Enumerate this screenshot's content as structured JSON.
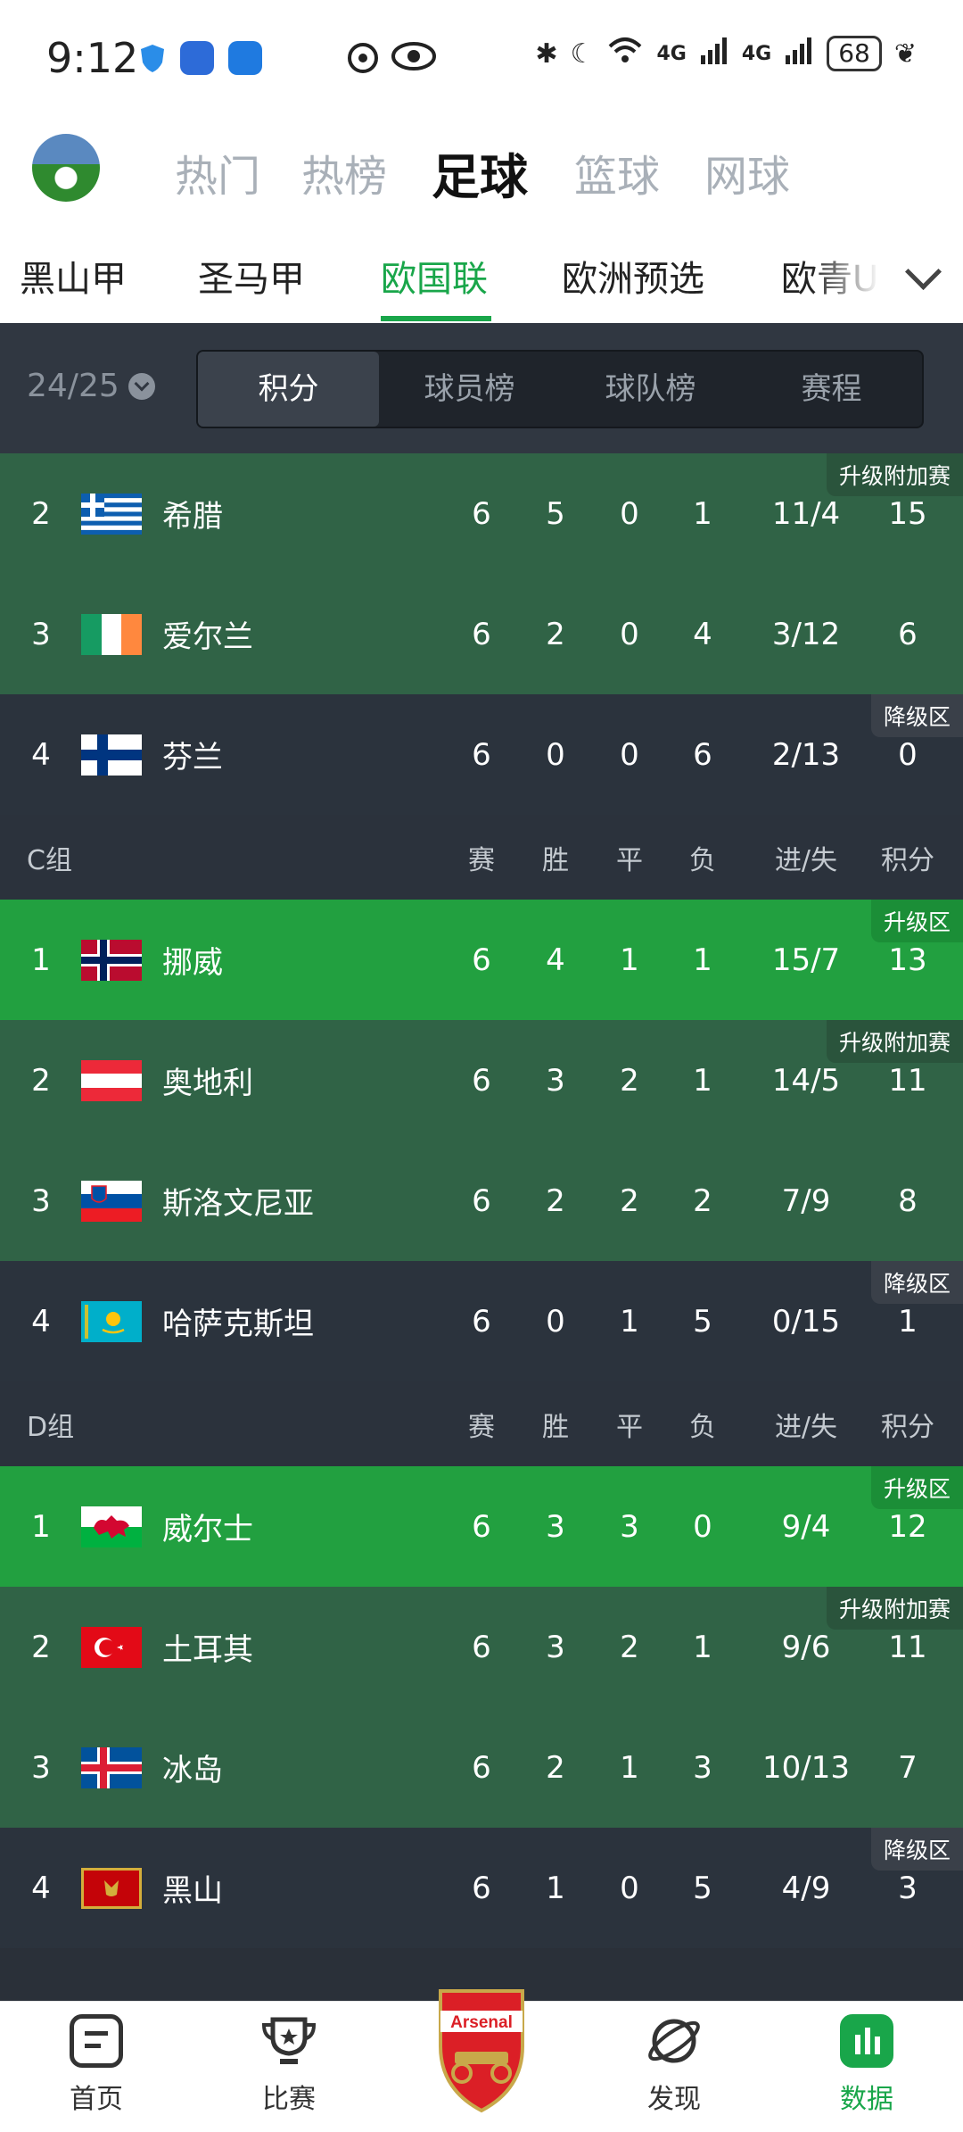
{
  "status_bar": {
    "time": "9:12",
    "signal_left": "4G",
    "signal_right": "4G",
    "battery": "68"
  },
  "sport_tabs": [
    {
      "label": "热门",
      "active": false
    },
    {
      "label": "热榜",
      "active": false
    },
    {
      "label": "足球",
      "active": true
    },
    {
      "label": "篮球",
      "active": false
    },
    {
      "label": "网球",
      "active": false
    }
  ],
  "league_tabs": [
    {
      "label": "黑山甲",
      "active": false
    },
    {
      "label": "圣马甲",
      "active": false
    },
    {
      "label": "欧国联",
      "active": true
    },
    {
      "label": "欧洲预选",
      "active": false
    },
    {
      "label": "欧青U",
      "active": false
    }
  ],
  "season": "24/25",
  "segments": [
    {
      "label": "积分",
      "active": true
    },
    {
      "label": "球员榜",
      "active": false
    },
    {
      "label": "球队榜",
      "active": false
    },
    {
      "label": "赛程",
      "active": false
    }
  ],
  "columns": {
    "played": "赛",
    "won": "胜",
    "drawn": "平",
    "lost": "负",
    "goals": "进/失",
    "points": "积分"
  },
  "groups": [
    {
      "name": "",
      "rows": [
        {
          "rank": "2",
          "team": "希腊",
          "flag": "greece",
          "p": "6",
          "w": "5",
          "d": "0",
          "l": "1",
          "gd": "11/4",
          "pts": "15",
          "zone": "升级附加赛",
          "zone_type": "playoff"
        },
        {
          "rank": "3",
          "team": "爱尔兰",
          "flag": "ireland",
          "p": "6",
          "w": "2",
          "d": "0",
          "l": "4",
          "gd": "3/12",
          "pts": "6",
          "zone": "",
          "zone_type": "playoff"
        },
        {
          "rank": "4",
          "team": "芬兰",
          "flag": "finland",
          "p": "6",
          "w": "0",
          "d": "0",
          "l": "6",
          "gd": "2/13",
          "pts": "0",
          "zone": "降级区",
          "zone_type": "relegate"
        }
      ]
    },
    {
      "name": "C组",
      "rows": [
        {
          "rank": "1",
          "team": "挪威",
          "flag": "norway",
          "p": "6",
          "w": "4",
          "d": "1",
          "l": "1",
          "gd": "15/7",
          "pts": "13",
          "zone": "升级区",
          "zone_type": "promote"
        },
        {
          "rank": "2",
          "team": "奥地利",
          "flag": "austria",
          "p": "6",
          "w": "3",
          "d": "2",
          "l": "1",
          "gd": "14/5",
          "pts": "11",
          "zone": "升级附加赛",
          "zone_type": "playoff"
        },
        {
          "rank": "3",
          "team": "斯洛文尼亚",
          "flag": "slovenia",
          "p": "6",
          "w": "2",
          "d": "2",
          "l": "2",
          "gd": "7/9",
          "pts": "8",
          "zone": "",
          "zone_type": "playoff"
        },
        {
          "rank": "4",
          "team": "哈萨克斯坦",
          "flag": "kazakhstan",
          "p": "6",
          "w": "0",
          "d": "1",
          "l": "5",
          "gd": "0/15",
          "pts": "1",
          "zone": "降级区",
          "zone_type": "relegate"
        }
      ]
    },
    {
      "name": "D组",
      "rows": [
        {
          "rank": "1",
          "team": "威尔士",
          "flag": "wales",
          "p": "6",
          "w": "3",
          "d": "3",
          "l": "0",
          "gd": "9/4",
          "pts": "12",
          "zone": "升级区",
          "zone_type": "promote"
        },
        {
          "rank": "2",
          "team": "土耳其",
          "flag": "turkey",
          "p": "6",
          "w": "3",
          "d": "2",
          "l": "1",
          "gd": "9/6",
          "pts": "11",
          "zone": "升级附加赛",
          "zone_type": "playoff"
        },
        {
          "rank": "3",
          "team": "冰岛",
          "flag": "iceland",
          "p": "6",
          "w": "2",
          "d": "1",
          "l": "3",
          "gd": "10/13",
          "pts": "7",
          "zone": "",
          "zone_type": "playoff"
        },
        {
          "rank": "4",
          "team": "黑山",
          "flag": "montenegro",
          "p": "6",
          "w": "1",
          "d": "0",
          "l": "5",
          "gd": "4/9",
          "pts": "3",
          "zone": "降级区",
          "zone_type": "relegate"
        }
      ]
    }
  ],
  "bottom_nav": [
    {
      "label": "首页",
      "icon": "home-icon",
      "active": false
    },
    {
      "label": "比赛",
      "icon": "trophy-icon",
      "active": false
    },
    {
      "label": "",
      "icon": "arsenal-crest-icon",
      "crest_text": "Arsenal",
      "active": false
    },
    {
      "label": "发现",
      "icon": "planet-icon",
      "active": false
    },
    {
      "label": "数据",
      "icon": "data-bars-icon",
      "active": true
    }
  ],
  "colors": {
    "accent": "#19a64a",
    "promote": "#22a040",
    "playoff": "#306346",
    "relegate": "#2b333d"
  }
}
